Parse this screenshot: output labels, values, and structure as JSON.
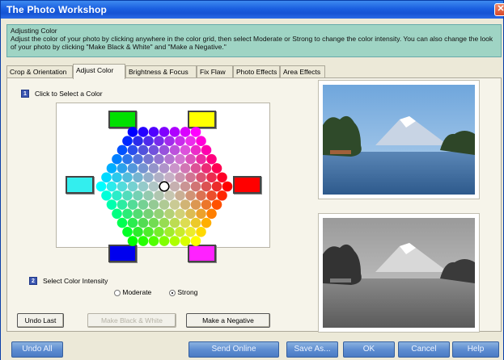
{
  "window": {
    "title": "The Photo Workshop",
    "close_glyph": "✕"
  },
  "info": {
    "heading": "Adjusting Color",
    "body": "Adjust the color of your photo by clicking anywhere in the color grid, then select Moderate or Strong to change the color intensity.  You can also change the look of your photo by clicking \"Make Black & White\" and \"Make a Negative.\""
  },
  "tabs": [
    {
      "label": "Crop & Orientation"
    },
    {
      "label": "Adjust Color"
    },
    {
      "label": "Brightness & Focus"
    },
    {
      "label": "Fix Flaw"
    },
    {
      "label": "Photo Effects"
    },
    {
      "label": "Area Effects"
    }
  ],
  "step1": {
    "number": "1",
    "label": "Click to Select a Color"
  },
  "step2": {
    "number": "2",
    "label": "Select Color Intensity"
  },
  "intensity": {
    "options": [
      "Moderate",
      "Strong"
    ],
    "selected": "Strong"
  },
  "swatches": {
    "green": "#00e000",
    "yellow": "#ffff00",
    "cyan": "#33eeee",
    "red": "#ff0000",
    "blue": "#0000ee",
    "magenta": "#ff22ff"
  },
  "buttons": {
    "undo_last": "Undo Last",
    "make_bw": "Make Black & White",
    "make_negative": "Make a Negative"
  },
  "bottom_buttons": {
    "undo_all": "Undo All",
    "send_online": "Send Online",
    "save_as": "Save As...",
    "ok": "OK",
    "cancel": "Cancel",
    "help": "Help"
  },
  "colors": {
    "title_bar": "#1a5fe0",
    "info_bg": "#9fd4c4",
    "panel_bg": "#f6f4ea",
    "bottom_button": "#5b8bd0"
  }
}
